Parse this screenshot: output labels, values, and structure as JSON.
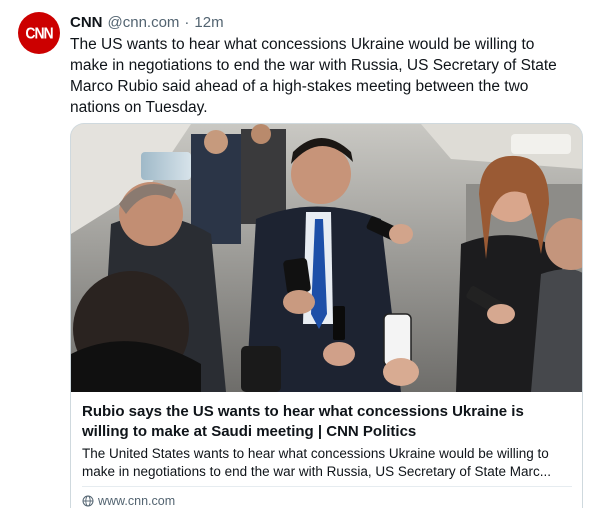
{
  "post": {
    "author": {
      "name": "CNN",
      "handle": "@cnn.com",
      "avatar_text": "CNN",
      "avatar_color": "#cc0000"
    },
    "separator": "·",
    "timestamp": "12m",
    "text": "The US wants to hear what concessions Ukraine would be willing to make in negotiations to end the war with Russia, US Secretary of State Marco Rubio said ahead of a high-stakes meeting between the two nations on Tuesday."
  },
  "link_card": {
    "title": "Rubio says the US wants to hear what concessions Ukraine is willing to make at Saudi meeting | CNN Politics",
    "description_line1": "The United States wants to hear what concessions Ukraine would be willing to",
    "description_line2": "make in negotiations to end the war with Russia, US Secretary of State Marc...",
    "domain": "www.cnn.com",
    "domain_icon": "globe-icon"
  },
  "colors": {
    "text_primary": "#0f1419",
    "text_secondary": "#536471",
    "border": "#cfd9de"
  }
}
